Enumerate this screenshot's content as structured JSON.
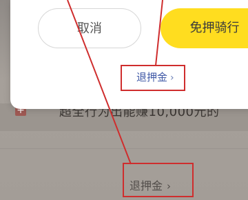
{
  "background": {
    "badge_text": "+",
    "description_text": "超全行为出能赚10,000元的",
    "refund_link_label": "退押金",
    "refund_arrow": "›"
  },
  "modal": {
    "cancel_label": "取消",
    "ride_label": "免押骑行",
    "refund_link_label": "退押金",
    "refund_arrow": "›"
  },
  "colors": {
    "accent_yellow": "#ffdd1f",
    "annotation_red": "#cf2d2d",
    "link_blue": "#3f58a6"
  }
}
